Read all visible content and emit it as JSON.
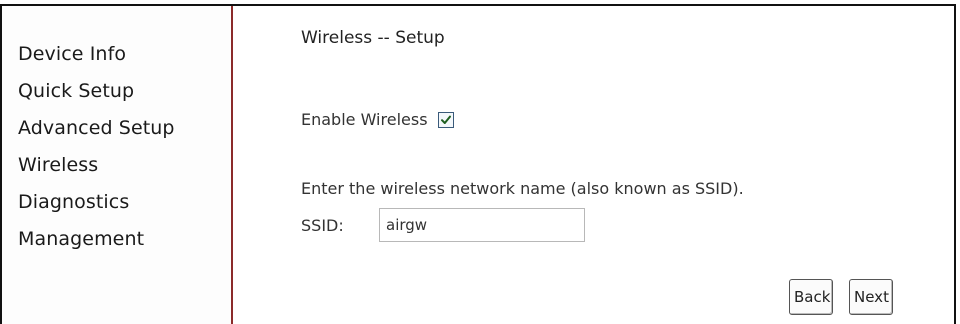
{
  "sidebar": {
    "items": [
      {
        "label": "Device Info"
      },
      {
        "label": "Quick Setup"
      },
      {
        "label": "Advanced Setup"
      },
      {
        "label": "Wireless"
      },
      {
        "label": "Diagnostics"
      },
      {
        "label": "Management"
      }
    ]
  },
  "main": {
    "title": "Wireless -- Setup",
    "enable_wireless": {
      "label": "Enable Wireless",
      "checked": true
    },
    "hint": "Enter the wireless network name (also known as SSID).",
    "ssid": {
      "label": "SSID:",
      "value": "airgw"
    },
    "buttons": {
      "back": "Back",
      "next": "Next"
    }
  },
  "colors": {
    "divider": "#8b2a2a",
    "checkbox_border": "#3a5a7a",
    "checkmark": "#1f5f1f"
  },
  "icons": {
    "checkbox": "check-icon"
  }
}
